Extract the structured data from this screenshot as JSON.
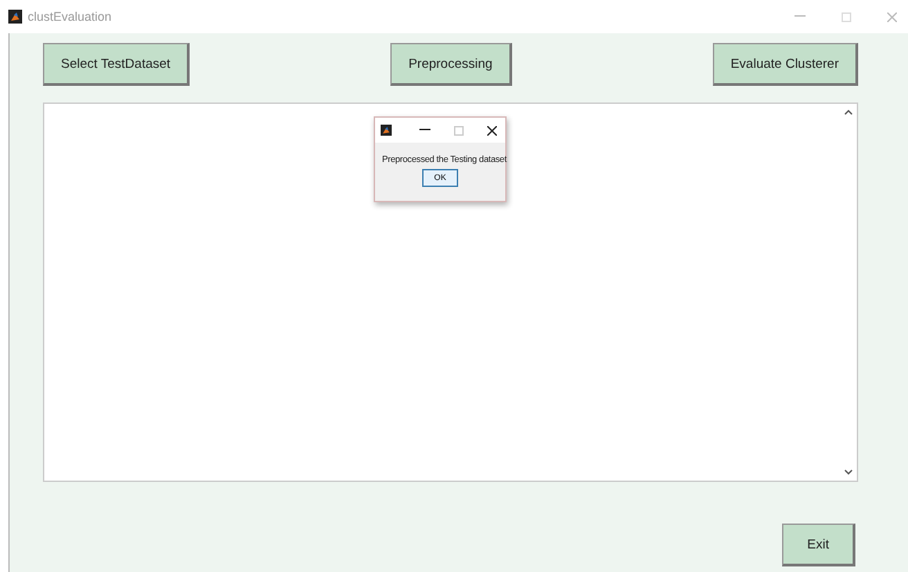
{
  "window": {
    "title": "clustEvaluation"
  },
  "buttons": [
    {
      "label": "Select TestDataset"
    },
    {
      "label": "Preprocessing"
    },
    {
      "label": "Evaluate Clusterer"
    }
  ],
  "dialog": {
    "message": "Preprocessed the Testing dataset",
    "button": "OK"
  },
  "exit_button": {
    "label": "Exit"
  }
}
